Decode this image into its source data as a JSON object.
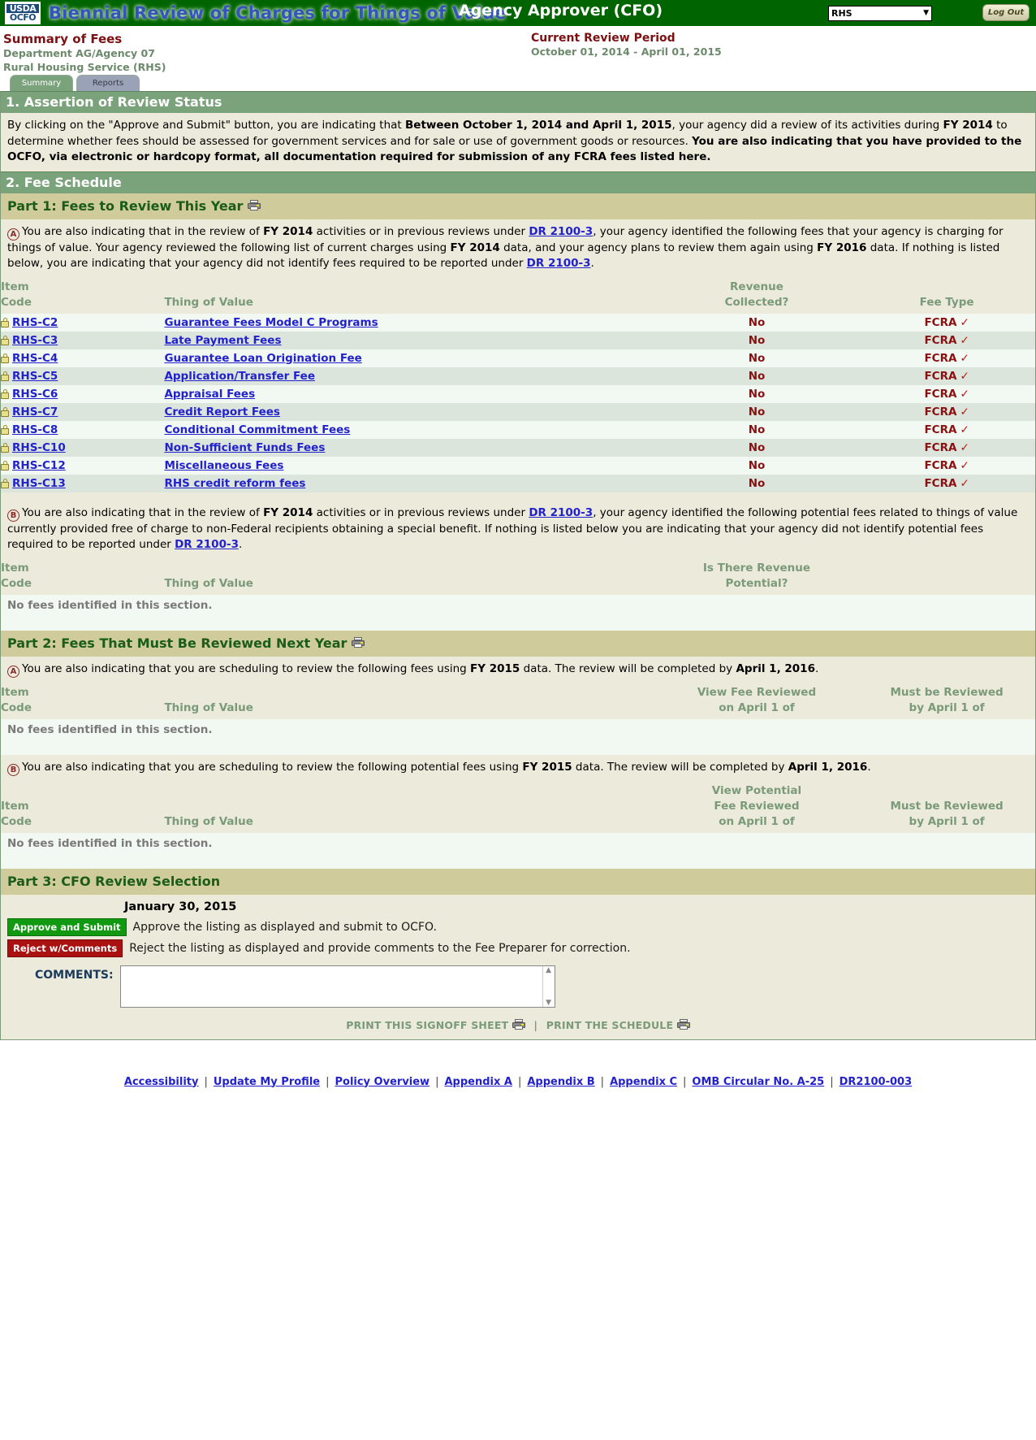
{
  "header": {
    "logo_line1": "USDA",
    "logo_line2": "OCFO",
    "app_title": "Biennial Review of Charges for Things of Value",
    "role_title": "Agency Approver (CFO)",
    "agency_selected": "RHS",
    "logout_label": "Log Out"
  },
  "summary": {
    "title": "Summary of Fees",
    "department": "Department AG/Agency 07",
    "agency": "Rural Housing Service (RHS)",
    "review_period_title": "Current Review Period",
    "review_period_dates": "October 01, 2014 - April 01, 2015"
  },
  "tabs": [
    {
      "label": "Summary",
      "active": true
    },
    {
      "label": "Reports",
      "active": false
    }
  ],
  "section1": {
    "heading": "1. Assertion of Review Status",
    "p_a": "By clicking on the \"Approve and Submit\" button, you are indicating that ",
    "p_b": "Between October 1, 2014 and April 1, 2015",
    "p_c": ", your agency did a review of its activities during ",
    "p_d": "FY 2014",
    "p_e": " to determine whether fees should be assessed for government services and for sale or use of government goods or resources. ",
    "p_f": "You are also indicating that you have provided to the OCFO, via electronic or hardcopy format, all documentation required for submission of any FCRA fees listed here."
  },
  "section2": {
    "heading": "2. Fee Schedule",
    "part1": {
      "title": "Part 1: Fees to Review This Year",
      "a": {
        "badge": "A",
        "t1": "You are also indicating that in the review of ",
        "fy1": "FY 2014",
        "t2": " activities or in previous reviews under ",
        "link1": "DR 2100-3",
        "t3": ", your agency identified the following fees that your agency is charging for things of value. Your agency reviewed the following list of current charges using ",
        "fy2": "FY 2014",
        "t4": " data, and your agency plans to review them again using ",
        "fy3": "FY 2016",
        "t5": " data. If nothing is listed below, you are indicating that your agency did not identify fees required to be reported under ",
        "link2": "DR 2100-3",
        "t6": ".",
        "columns": {
          "item_code_l1": "Item",
          "item_code_l2": "Code",
          "thing_of_value": "Thing of Value",
          "revenue_l1": "Revenue",
          "revenue_l2": "Collected?",
          "fee_type": "Fee Type"
        },
        "rows": [
          {
            "code": "RHS-C2",
            "name": "Guarantee Fees Model C Programs",
            "revenue": "No",
            "fee_type": "FCRA",
            "check": "✓"
          },
          {
            "code": "RHS-C3",
            "name": "Late Payment Fees",
            "revenue": "No",
            "fee_type": "FCRA",
            "check": "✓"
          },
          {
            "code": "RHS-C4",
            "name": "Guarantee Loan Origination Fee",
            "revenue": "No",
            "fee_type": "FCRA",
            "check": "✓"
          },
          {
            "code": "RHS-C5",
            "name": "Application/Transfer Fee",
            "revenue": "No",
            "fee_type": "FCRA",
            "check": "✓"
          },
          {
            "code": "RHS-C6",
            "name": "Appraisal Fees",
            "revenue": "No",
            "fee_type": "FCRA",
            "check": "✓"
          },
          {
            "code": "RHS-C7",
            "name": "Credit Report Fees",
            "revenue": "No",
            "fee_type": "FCRA",
            "check": "✓"
          },
          {
            "code": "RHS-C8",
            "name": "Conditional Commitment Fees",
            "revenue": "No",
            "fee_type": "FCRA",
            "check": "✓"
          },
          {
            "code": "RHS-C10",
            "name": "Non-Sufficient Funds Fees",
            "revenue": "No",
            "fee_type": "FCRA",
            "check": "✓"
          },
          {
            "code": "RHS-C12",
            "name": "Miscellaneous Fees",
            "revenue": "No",
            "fee_type": "FCRA",
            "check": "✓"
          },
          {
            "code": "RHS-C13",
            "name": "RHS credit reform fees",
            "revenue": "No",
            "fee_type": "FCRA",
            "check": "✓"
          }
        ]
      },
      "b": {
        "badge": "B",
        "t1": "You are also indicating that in the review of ",
        "fy1": "FY 2014",
        "t2": " activities or in previous reviews under ",
        "link1": "DR 2100-3",
        "t3": ", your agency identified the following potential fees related to things of value currently provided free of charge to non-Federal recipients obtaining a special benefit. If nothing is listed below you are indicating that your agency did not identify potential fees required to be reported under ",
        "link2": "DR 2100-3",
        "t4": ".",
        "columns": {
          "item_code_l1": "Item",
          "item_code_l2": "Code",
          "thing_of_value": "Thing of Value",
          "revenue_l1": "Is There Revenue",
          "revenue_l2": "Potential?"
        },
        "empty_text": "No fees identified in this section."
      }
    },
    "part2": {
      "title": "Part 2: Fees That Must Be Reviewed Next Year",
      "a": {
        "badge": "A",
        "t1": "You are also indicating that you are scheduling to review the following fees using ",
        "fy1": "FY 2015",
        "t2": " data. The review will be completed by ",
        "date1": "April 1, 2016",
        "t3": ".",
        "columns": {
          "item_code_l1": "Item",
          "item_code_l2": "Code",
          "thing_of_value": "Thing of Value",
          "view_l1": "View Fee Reviewed",
          "view_l2": "on April 1 of",
          "must_l1": "Must be Reviewed",
          "must_l2": "by April 1 of"
        },
        "empty_text": "No fees identified in this section."
      },
      "b": {
        "badge": "B",
        "t1": "You are also indicating that you are scheduling to review the following potential fees using ",
        "fy1": "FY 2015",
        "t2": " data. The review will be completed by ",
        "date1": "April 1, 2016",
        "t3": ".",
        "columns": {
          "item_code_l1": "Item",
          "item_code_l2": "Code",
          "thing_of_value": "Thing of Value",
          "view_l1": "View Potential",
          "view_l2": "Fee Reviewed",
          "view_l3": "on April 1 of",
          "must_l1": "Must be Reviewed",
          "must_l2": "by April 1 of"
        },
        "empty_text": "No fees identified in this section."
      }
    },
    "part3": {
      "title": "Part 3: CFO Review Selection",
      "date": "January 30, 2015",
      "approve_button": "Approve and Submit",
      "approve_desc": "Approve the listing as displayed and submit to OCFO.",
      "reject_button": "Reject w/Comments",
      "reject_desc": "Reject the listing as displayed and provide comments to the Fee Preparer for correction.",
      "comments_label": "COMMENTS:",
      "comments_value": "",
      "print_signoff": "PRINT THIS SIGNOFF SHEET",
      "print_schedule": "PRINT THE SCHEDULE"
    }
  },
  "footer": {
    "links": [
      "Accessibility",
      "Update My Profile",
      "Policy Overview",
      "Appendix A",
      "Appendix B",
      "Appendix C",
      "OMB Circular No. A-25",
      "DR2100-003"
    ]
  },
  "colors": {
    "green_bar": "#006400",
    "section_green": "#7ba37b",
    "part_tan": "#cfcb9b",
    "cream": "#eceadb",
    "mint": "#f2f8f2",
    "row_alt": "#dce5dc",
    "link_blue": "#2222cc",
    "maroon": "#7b1113",
    "approve_green": "#119911",
    "reject_red": "#aa1111"
  }
}
